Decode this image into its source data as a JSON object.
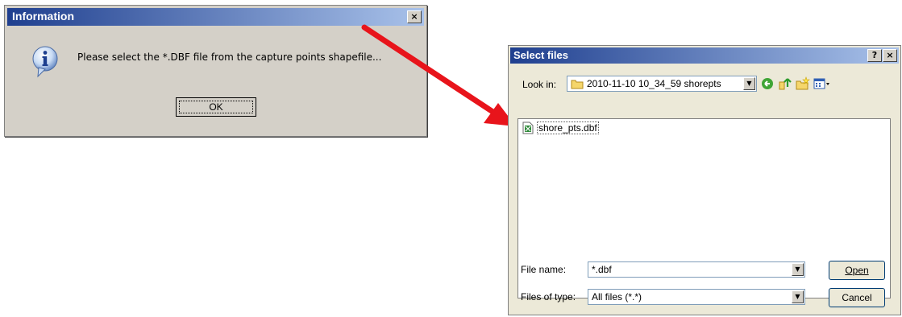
{
  "info_dialog": {
    "title": "Information",
    "close_label": "×",
    "message": "Please select the *.DBF file from the capture points shapefile...",
    "ok_label": "OK"
  },
  "select_dialog": {
    "title": "Select files",
    "help_label": "?",
    "close_label": "×",
    "look_in_label": "Look in:",
    "look_in_value": "2010-11-10 10_34_59 shorepts",
    "files": [
      {
        "name": "shore_pts.dbf"
      }
    ],
    "file_name_label": "File name:",
    "file_name_value": "*.dbf",
    "files_of_type_label": "Files of type:",
    "files_of_type_value": "All files (*.*)",
    "open_label": "Open",
    "cancel_label": "Cancel"
  },
  "colors": {
    "title_bar_start": "#1f3f8f",
    "title_bar_end": "#a9c2ea",
    "arrow": "#e8141b"
  }
}
